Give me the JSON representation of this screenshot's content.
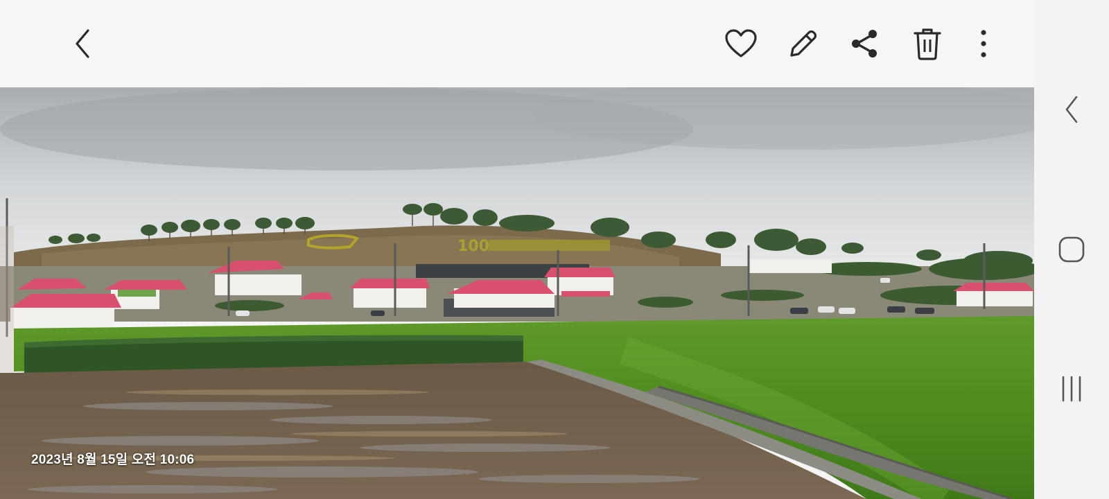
{
  "toolbar": {
    "back": {
      "icon": "chevron-left-icon"
    },
    "actions": [
      {
        "name": "favorite",
        "icon": "heart-outline-icon"
      },
      {
        "name": "edit",
        "icon": "pencil-icon"
      },
      {
        "name": "share",
        "icon": "share-icon"
      },
      {
        "name": "delete",
        "icon": "trash-icon"
      },
      {
        "name": "more",
        "icon": "more-vertical-icon"
      }
    ],
    "icon_color": "#2a2a2a"
  },
  "photo": {
    "timestamp": "2023년 8월 15일 오전 10:06",
    "hillside_text": "100"
  },
  "navigation_bar": {
    "buttons": [
      {
        "name": "back",
        "icon": "nav-back-icon"
      },
      {
        "name": "home",
        "icon": "nav-home-icon"
      },
      {
        "name": "recents",
        "icon": "nav-recents-icon"
      }
    ],
    "icon_color": "#555555"
  }
}
